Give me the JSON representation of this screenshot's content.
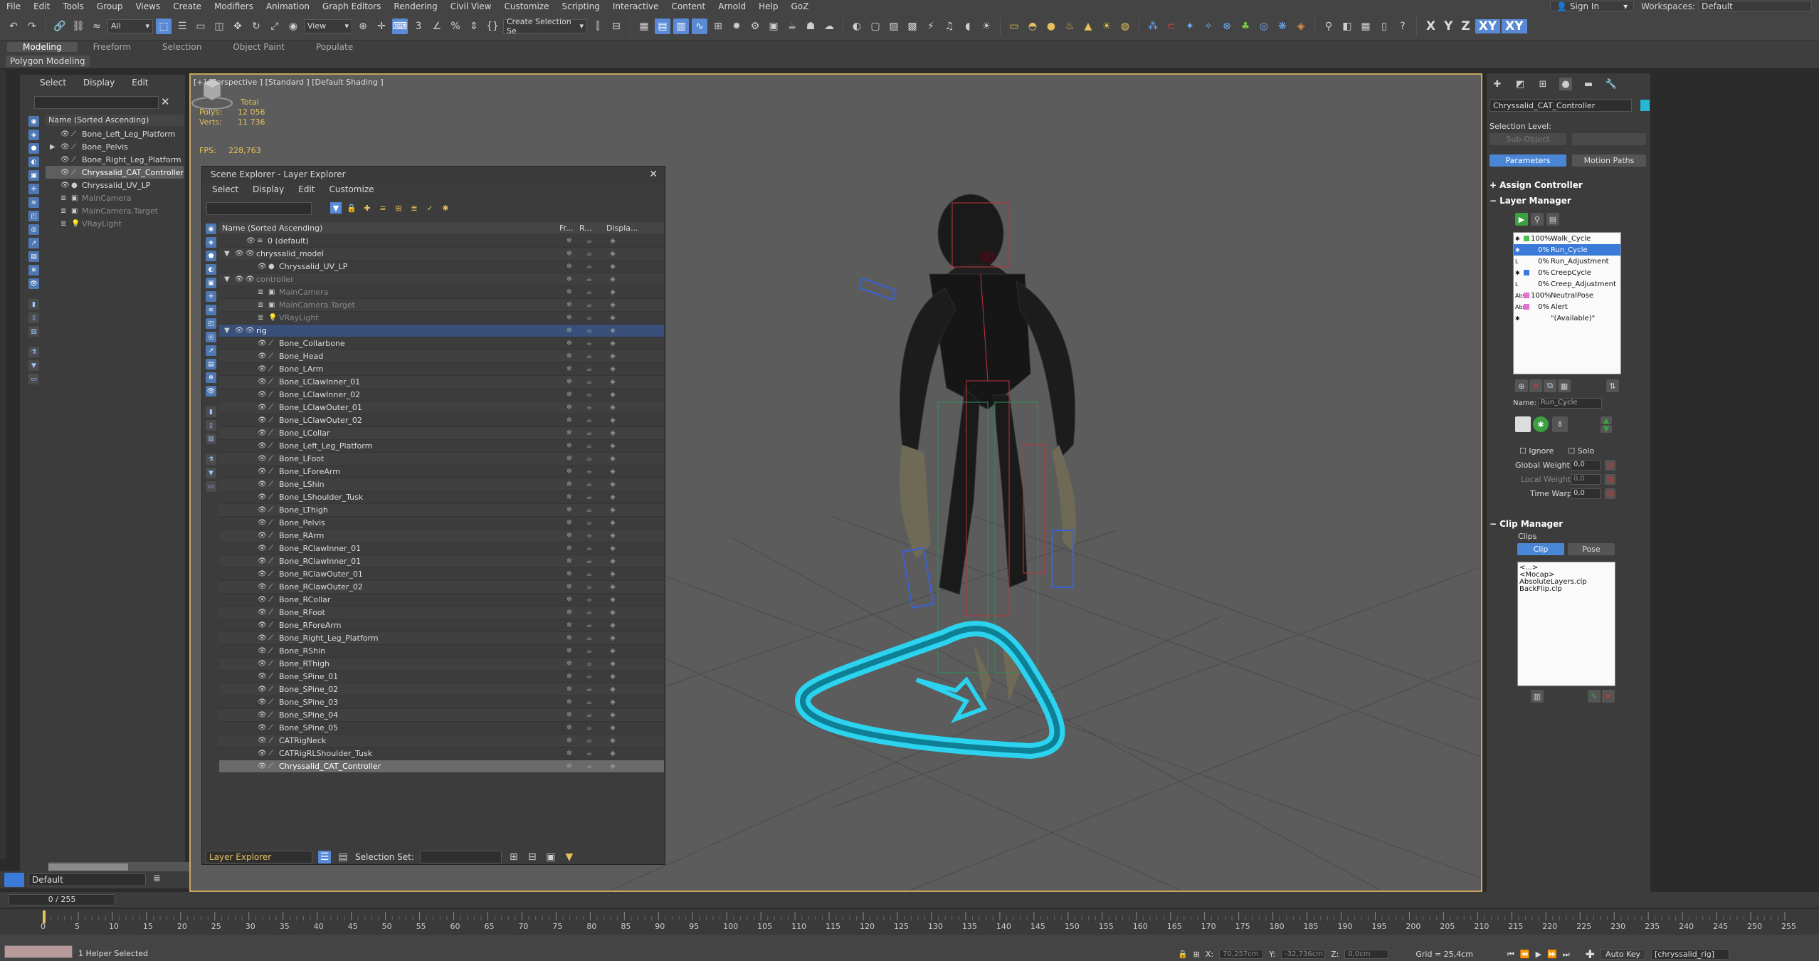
{
  "menu": {
    "items": [
      "File",
      "Edit",
      "Tools",
      "Group",
      "Views",
      "Create",
      "Modifiers",
      "Animation",
      "Graph Editors",
      "Rendering",
      "Civil View",
      "Customize",
      "Scripting",
      "Interactive",
      "Content",
      "Arnold",
      "Help",
      "GoZ"
    ],
    "sign_in": "Sign In",
    "workspaces_label": "Workspaces:",
    "workspace_value": "Default"
  },
  "toolbar": {
    "filter_value": "All",
    "view_value": "View",
    "selection_set_placeholder": "Create Selection Se",
    "axes": [
      "X",
      "Y",
      "Z",
      "XY",
      "XY"
    ]
  },
  "ribbon": {
    "tabs": [
      "Modeling",
      "Freeform",
      "Selection",
      "Object Paint",
      "Populate"
    ],
    "sub_label": "Polygon Modeling"
  },
  "explorer": {
    "menu": [
      "Select",
      "Display",
      "Edit"
    ],
    "header": "Name (Sorted Ascending)",
    "rows": [
      {
        "name": "Bone_Left_Leg_Platform",
        "kind": "bone",
        "state": "normal"
      },
      {
        "name": "Bone_Pelvis",
        "kind": "bone",
        "state": "normal",
        "expandable": true
      },
      {
        "name": "Bone_Right_Leg_Platform",
        "kind": "bone",
        "state": "normal"
      },
      {
        "name": "Chryssalid_CAT_Controller",
        "kind": "bone",
        "state": "selected"
      },
      {
        "name": "Chryssalid_UV_LP",
        "kind": "mesh",
        "state": "normal"
      },
      {
        "name": "MainCamera",
        "kind": "camera",
        "state": "dim"
      },
      {
        "name": "MainCamera.Target",
        "kind": "camera",
        "state": "dim"
      },
      {
        "name": "VRayLight",
        "kind": "light",
        "state": "dim"
      }
    ],
    "layer_value": "Default"
  },
  "viewport": {
    "label": "[+] [Perspective ] [Standard ] [Default Shading ]",
    "stats_header": "Total",
    "polys_label": "Polys:",
    "polys_value": "12 056",
    "verts_label": "Verts:",
    "verts_value": "11 736",
    "fps_label": "FPS:",
    "fps_value": "228,763"
  },
  "layer_explorer": {
    "title": "Scene Explorer - Layer Explorer",
    "menu": [
      "Select",
      "Display",
      "Edit",
      "Customize"
    ],
    "col_name": "Name (Sorted Ascending)",
    "col_fr": "Fr...",
    "col_r": "R...",
    "col_disp": "Displa...",
    "rows": [
      {
        "name": "0 (default)",
        "indent": 1,
        "kind": "layer",
        "state": "normal"
      },
      {
        "name": "chryssalid_model",
        "indent": 0,
        "kind": "layer",
        "state": "normal",
        "expanded": true
      },
      {
        "name": "Chryssalid_UV_LP",
        "indent": 2,
        "kind": "mesh",
        "state": "normal"
      },
      {
        "name": "controller",
        "indent": 0,
        "kind": "layer",
        "state": "dim",
        "expanded": true
      },
      {
        "name": "MainCamera",
        "indent": 2,
        "kind": "camera",
        "state": "dim"
      },
      {
        "name": "MainCamera.Target",
        "indent": 2,
        "kind": "camera",
        "state": "dim"
      },
      {
        "name": "VRayLight",
        "indent": 2,
        "kind": "light",
        "state": "dim"
      },
      {
        "name": "rig",
        "indent": 0,
        "kind": "layer",
        "state": "active",
        "expanded": true
      },
      {
        "name": "Bone_Collarbone",
        "indent": 2,
        "kind": "bone",
        "state": "normal"
      },
      {
        "name": "Bone_Head",
        "indent": 2,
        "kind": "bone",
        "state": "normal"
      },
      {
        "name": "Bone_LArm",
        "indent": 2,
        "kind": "bone",
        "state": "normal"
      },
      {
        "name": "Bone_LClawInner_01",
        "indent": 2,
        "kind": "bone",
        "state": "normal"
      },
      {
        "name": "Bone_LClawInner_02",
        "indent": 2,
        "kind": "bone",
        "state": "normal"
      },
      {
        "name": "Bone_LClawOuter_01",
        "indent": 2,
        "kind": "bone",
        "state": "normal"
      },
      {
        "name": "Bone_LClawOuter_02",
        "indent": 2,
        "kind": "bone",
        "state": "normal"
      },
      {
        "name": "Bone_LCollar",
        "indent": 2,
        "kind": "bone",
        "state": "normal"
      },
      {
        "name": "Bone_Left_Leg_Platform",
        "indent": 2,
        "kind": "bone",
        "state": "normal"
      },
      {
        "name": "Bone_LFoot",
        "indent": 2,
        "kind": "bone",
        "state": "normal"
      },
      {
        "name": "Bone_LForeArm",
        "indent": 2,
        "kind": "bone",
        "state": "normal"
      },
      {
        "name": "Bone_LShin",
        "indent": 2,
        "kind": "bone",
        "state": "normal"
      },
      {
        "name": "Bone_LShoulder_Tusk",
        "indent": 2,
        "kind": "bone",
        "state": "normal"
      },
      {
        "name": "Bone_LThigh",
        "indent": 2,
        "kind": "bone",
        "state": "normal"
      },
      {
        "name": "Bone_Pelvis",
        "indent": 2,
        "kind": "bone",
        "state": "normal"
      },
      {
        "name": "Bone_RArm",
        "indent": 2,
        "kind": "bone",
        "state": "normal"
      },
      {
        "name": "Bone_RClawInner_01",
        "indent": 2,
        "kind": "bone",
        "state": "normal"
      },
      {
        "name": "Bone_RClawInner_01",
        "indent": 2,
        "kind": "bone",
        "state": "normal"
      },
      {
        "name": "Bone_RClawOuter_01",
        "indent": 2,
        "kind": "bone",
        "state": "normal"
      },
      {
        "name": "Bone_RClawOuter_02",
        "indent": 2,
        "kind": "bone",
        "state": "normal"
      },
      {
        "name": "Bone_RCollar",
        "indent": 2,
        "kind": "bone",
        "state": "normal"
      },
      {
        "name": "Bone_RFoot",
        "indent": 2,
        "kind": "bone",
        "state": "normal"
      },
      {
        "name": "Bone_RForeArm",
        "indent": 2,
        "kind": "bone",
        "state": "normal"
      },
      {
        "name": "Bone_Right_Leg_Platform",
        "indent": 2,
        "kind": "bone",
        "state": "normal"
      },
      {
        "name": "Bone_RShin",
        "indent": 2,
        "kind": "bone",
        "state": "normal"
      },
      {
        "name": "Bone_RThigh",
        "indent": 2,
        "kind": "bone",
        "state": "normal"
      },
      {
        "name": "Bone_SPine_01",
        "indent": 2,
        "kind": "bone",
        "state": "normal"
      },
      {
        "name": "Bone_SPine_02",
        "indent": 2,
        "kind": "bone",
        "state": "normal"
      },
      {
        "name": "Bone_SPine_03",
        "indent": 2,
        "kind": "bone",
        "state": "normal"
      },
      {
        "name": "Bone_SPine_04",
        "indent": 2,
        "kind": "bone",
        "state": "normal"
      },
      {
        "name": "Bone_SPine_05",
        "indent": 2,
        "kind": "bone",
        "state": "normal"
      },
      {
        "name": "CATRigNeck",
        "indent": 2,
        "kind": "bone",
        "state": "normal"
      },
      {
        "name": "CATRigRLShoulder_Tusk",
        "indent": 2,
        "kind": "bone",
        "state": "normal"
      },
      {
        "name": "Chryssalid_CAT_Controller",
        "indent": 2,
        "kind": "bone",
        "state": "selected"
      }
    ],
    "footer_label": "Layer Explorer",
    "selection_set_label": "Selection Set:"
  },
  "command_panel": {
    "object_name": "Chryssalid_CAT_Controller",
    "object_color": "#27b7d4",
    "selection_level_label": "Selection Level:",
    "sub_object": "Sub-Object",
    "parameters_btn": "Parameters",
    "motion_paths_btn": "Motion Paths",
    "assign_controller": "Assign Controller",
    "layer_manager": "Layer Manager",
    "layers": [
      {
        "pct": "100%",
        "name": "Walk_Cycle",
        "color": "#4cc24c",
        "selected": false,
        "icon": ""
      },
      {
        "pct": "0%",
        "name": "Run_Cycle",
        "color": "#3a7ad8",
        "selected": true,
        "icon": ""
      },
      {
        "pct": "0%",
        "name": "Run_Adjustment",
        "color": "",
        "selected": false,
        "icon": "L"
      },
      {
        "pct": "0%",
        "name": "CreepCycle",
        "color": "#3a7ad8",
        "selected": false,
        "icon": ""
      },
      {
        "pct": "0%",
        "name": "Creep_Adjustment",
        "color": "",
        "selected": false,
        "icon": "L"
      },
      {
        "pct": "100%",
        "name": "NeutralPose",
        "color": "#e070d0",
        "selected": false,
        "icon": "Abs"
      },
      {
        "pct": "0%",
        "name": "Alert",
        "color": "#e070d0",
        "selected": false,
        "icon": "Abs"
      },
      {
        "pct": "",
        "name": "\"(Available)\"",
        "color": "",
        "selected": false,
        "icon": ""
      }
    ],
    "name_label": "Name:",
    "name_value": "Run_Cycle",
    "ignore_label": "Ignore",
    "solo_label": "Solo",
    "global_weight_label": "Global Weight:",
    "global_weight_value": "0,0",
    "local_weight_label": "Local Weight:",
    "local_weight_value": "0,0",
    "time_warp_label": "Time Warp:",
    "time_warp_value": "0,0",
    "clip_manager": "Clip Manager",
    "clips_label": "Clips",
    "clip_btn": "Clip",
    "pose_btn": "Pose",
    "clips": [
      "<...>",
      "<Mocap>",
      "AbsoluteLayers.clp",
      "BackFlip.clp"
    ]
  },
  "timeline": {
    "frame_value": "0 / 255",
    "ticks": [
      "0",
      "5",
      "10",
      "15",
      "20",
      "25",
      "30",
      "35",
      "40",
      "45",
      "50",
      "55",
      "60",
      "65",
      "70",
      "75",
      "80",
      "85",
      "90",
      "95",
      "100",
      "105",
      "110",
      "115",
      "120",
      "125",
      "130",
      "135",
      "140",
      "145",
      "150",
      "155",
      "160",
      "165",
      "170",
      "175",
      "180",
      "185",
      "190",
      "195",
      "200",
      "205",
      "210",
      "215",
      "220",
      "225",
      "230",
      "235",
      "240",
      "245",
      "250",
      "255"
    ]
  },
  "status": {
    "selection_text": "1 Helper Selected",
    "x_label": "X:",
    "x_value": "70,257cm",
    "y_label": "Y:",
    "y_value": "-32,736cm",
    "z_label": "Z:",
    "z_value": "0,0cm",
    "grid_text": "Grid = 25,4cm",
    "auto_key": "Auto Key",
    "key_set": "[chryssalid_rig]"
  }
}
